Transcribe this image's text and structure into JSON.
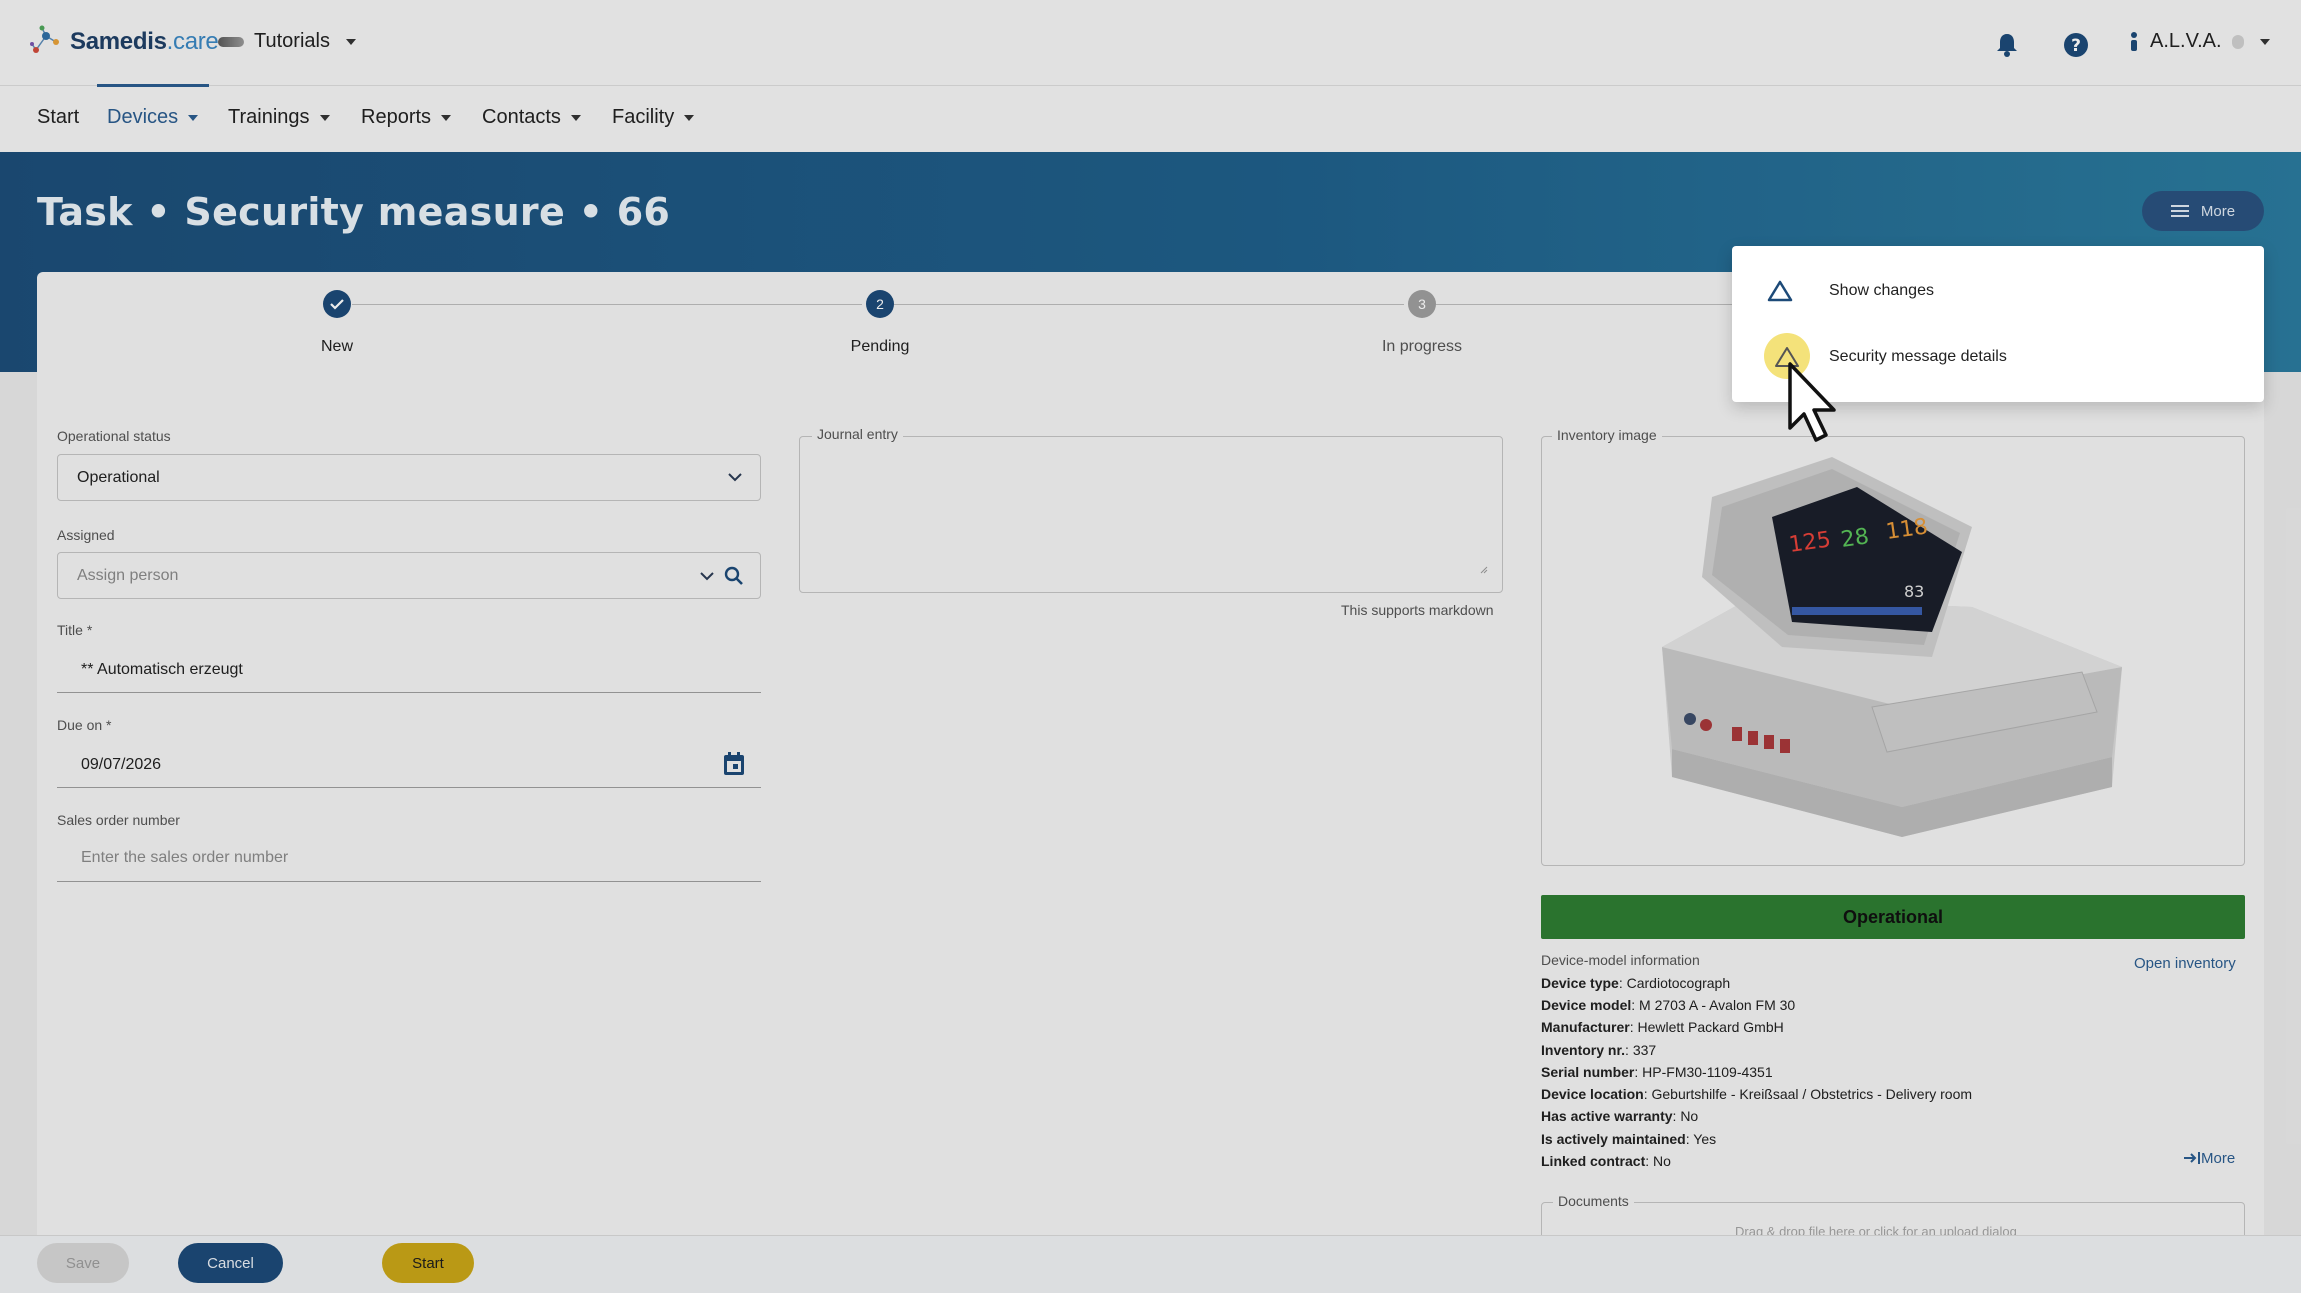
{
  "topbar": {
    "logo": {
      "samedis": "Samedis",
      "care": ".care"
    },
    "tenant": "Tutorials",
    "user": "A.L.V.A."
  },
  "nav": {
    "items": [
      "Start",
      "Devices",
      "Trainings",
      "Reports",
      "Contacts",
      "Facility"
    ],
    "active": "Devices"
  },
  "page": {
    "title": "Task • Security measure • 66",
    "more_label": "More"
  },
  "stepper": {
    "steps": [
      {
        "label": "New",
        "marker": "✓",
        "state": "done"
      },
      {
        "label": "Pending",
        "marker": "2",
        "state": "active"
      },
      {
        "label": "In progress",
        "marker": "3",
        "state": "upcoming"
      }
    ]
  },
  "form": {
    "operation_status": {
      "label": "Operational status",
      "value": "Operational"
    },
    "assigned": {
      "label": "Assigned",
      "placeholder": "Assign person"
    },
    "title": {
      "label": "Title *",
      "value": "** Automatisch erzeugt"
    },
    "due_on": {
      "label": "Due on *",
      "value": "09/07/2026"
    },
    "sales_order": {
      "label": "Sales order number",
      "placeholder": "Enter the sales order number"
    }
  },
  "journal": {
    "label": "Journal entry",
    "hint": "This supports markdown"
  },
  "inventory": {
    "image_label": "Inventory image",
    "status_banner": "Operational",
    "status_color": "#2e7d32",
    "model_info_title": "Device-model information",
    "open_inventory": "Open inventory",
    "details": [
      {
        "key": "Device type",
        "value": "Cardiotocograph"
      },
      {
        "key": "Device model",
        "value": "M 2703 A - Avalon FM 30"
      },
      {
        "key": "Manufacturer",
        "value": "Hewlett Packard GmbH"
      },
      {
        "key": "Inventory nr.",
        "value": "337"
      },
      {
        "key": "Serial number",
        "value": "HP-FM30-1109-4351"
      },
      {
        "key": "Device location",
        "value": "Geburtshilfe - Kreißsaal / Obstetrics - Delivery room"
      },
      {
        "key": "Has active warranty",
        "value": "No"
      },
      {
        "key": "Is actively maintained",
        "value": "Yes"
      },
      {
        "key": "Linked contract",
        "value": "No"
      }
    ],
    "more_link": "More",
    "documents_label": "Documents",
    "documents_hint": "Drag & drop file here or click for an upload dialog"
  },
  "actions": {
    "save": "Save",
    "cancel": "Cancel",
    "start": "Start"
  },
  "menu": {
    "items": [
      {
        "label": "Show changes",
        "icon": "triangle-icon"
      },
      {
        "label": "Security message details",
        "icon": "triangle-icon"
      }
    ]
  },
  "colors": {
    "primary": "#1d4a78",
    "accent_yellow": "#c9a617",
    "link": "#2b5c8f"
  }
}
